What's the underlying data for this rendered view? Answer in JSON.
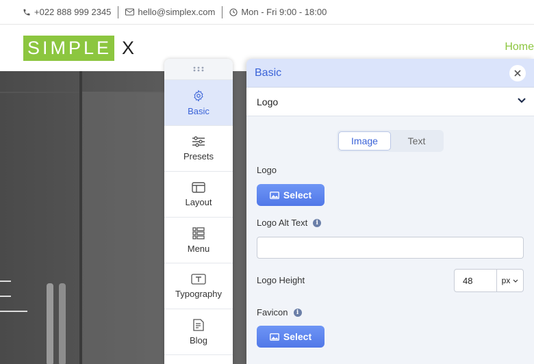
{
  "topbar": {
    "phone": "+022 888 999 2345",
    "email": "hello@simplex.com",
    "hours": "Mon - Fri 9:00 - 18:00"
  },
  "header": {
    "logo_main": "SIMPLE",
    "logo_suffix": "X",
    "nav_home": "Home"
  },
  "colors": {
    "brand_green": "#8cc63f",
    "accent_blue": "#3a63d8",
    "button_blue": "#5b82ee"
  },
  "tabs": [
    {
      "label": "Basic",
      "icon": "gear-icon",
      "active": true
    },
    {
      "label": "Presets",
      "icon": "sliders-icon",
      "active": false
    },
    {
      "label": "Layout",
      "icon": "layout-icon",
      "active": false
    },
    {
      "label": "Menu",
      "icon": "menu-icon",
      "active": false
    },
    {
      "label": "Typography",
      "icon": "typography-icon",
      "active": false
    },
    {
      "label": "Blog",
      "icon": "blog-icon",
      "active": false
    }
  ],
  "panel": {
    "title": "Basic",
    "section": "Logo",
    "segment": {
      "options": [
        "Image",
        "Text"
      ],
      "selected": "Image"
    },
    "logo_label": "Logo",
    "select_label": "Select",
    "alt_text_label": "Logo Alt Text",
    "alt_text_value": "",
    "height_label": "Logo Height",
    "height_value": "48",
    "height_unit": "px",
    "favicon_label": "Favicon",
    "favicon_select_label": "Select"
  }
}
